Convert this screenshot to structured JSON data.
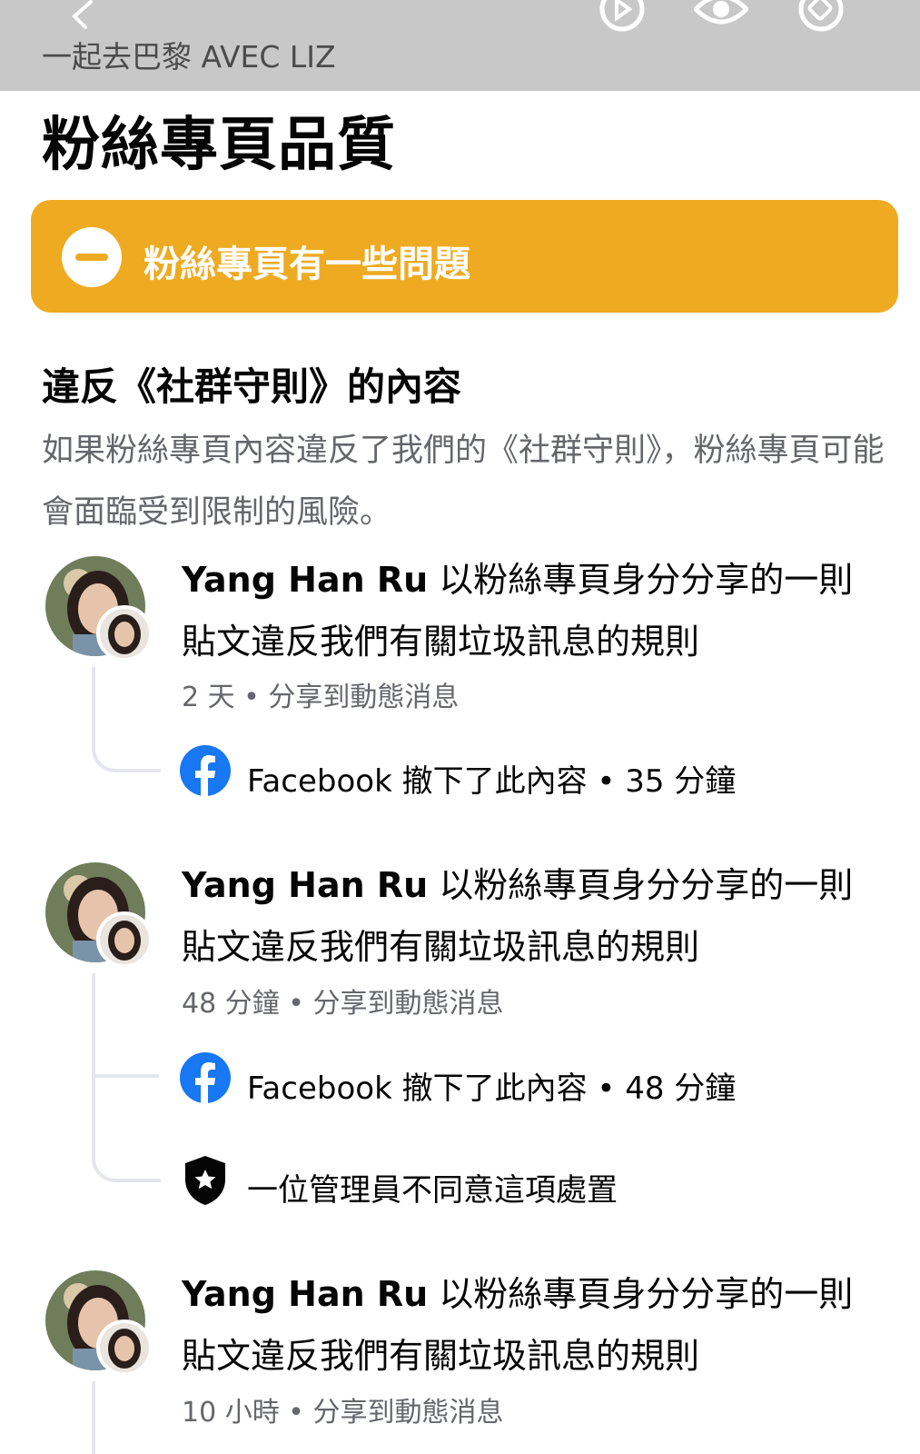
{
  "header": {
    "page_name": "一起去巴黎 AVEC LIZ",
    "back_icon": "chevron-left-icon",
    "icons": [
      "play-icon",
      "eye-icon",
      "tag-icon"
    ]
  },
  "title": "粉絲專頁品質",
  "status_banner": {
    "text": "粉絲專頁有一些問題",
    "icon": "minus-circle-icon",
    "color": "#eeab22"
  },
  "section": {
    "title": "違反《社群守則》的內容",
    "description": "如果粉絲專頁內容違反了我們的《社群守則》，粉絲專頁可能會面臨受到限制的風險。"
  },
  "violations": [
    {
      "author": "Yang Han Ru",
      "text": " 以粉絲專頁身分分享的一則貼文違反我們有關垃圾訊息的規則",
      "meta": "2 天 • 分享到動態消息",
      "actions": [
        {
          "icon": "facebook-icon",
          "text": "Facebook 撤下了此內容 • 35 分鐘"
        }
      ]
    },
    {
      "author": "Yang Han Ru",
      "text": " 以粉絲專頁身分分享的一則貼文違反我們有關垃圾訊息的規則",
      "meta": "48 分鐘 • 分享到動態消息",
      "actions": [
        {
          "icon": "facebook-icon",
          "text": "Facebook 撤下了此內容 • 48 分鐘"
        },
        {
          "icon": "shield-star-icon",
          "text": "一位管理員不同意這項處置"
        }
      ]
    },
    {
      "author": "Yang Han Ru",
      "text": " 以粉絲專頁身分分享的一則貼文違反我們有關垃圾訊息的規則",
      "meta": "10 小時 • 分享到動態消息",
      "actions": []
    }
  ],
  "colors": {
    "facebook_blue": "#1877f2",
    "secondary_text": "#65676b",
    "thread_line": "#e4e6eb"
  }
}
